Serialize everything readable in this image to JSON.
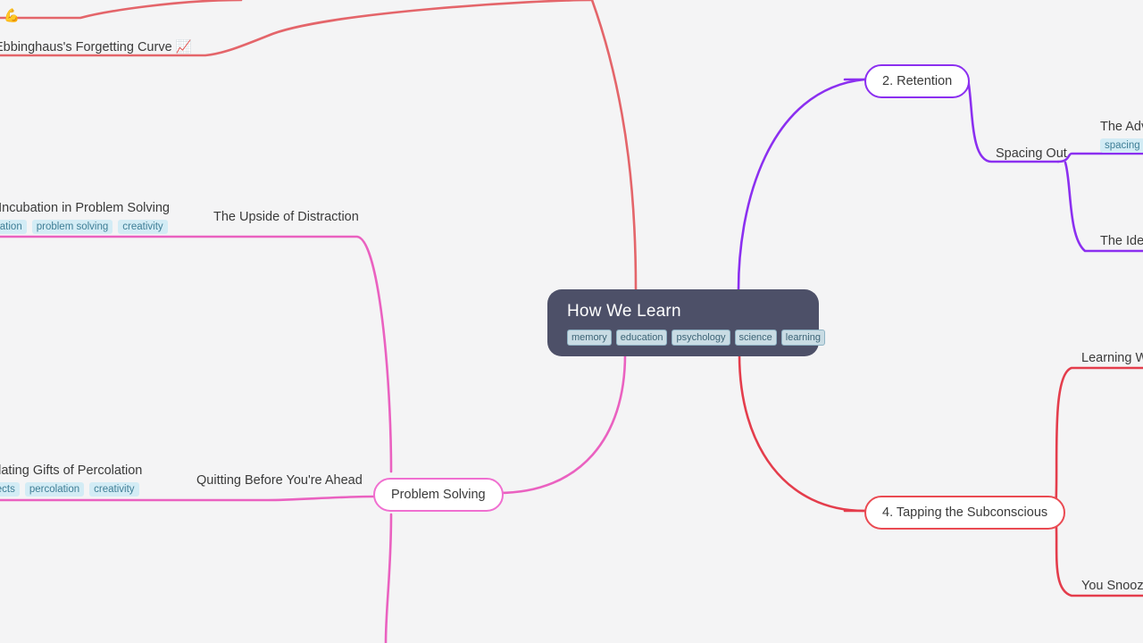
{
  "background_color": "#f4f4f5",
  "root": {
    "title": "How We Learn",
    "tags": [
      "memory",
      "education",
      "psychology",
      "science",
      "learning"
    ],
    "color": "#4d5068"
  },
  "branches": [
    {
      "id": "retention",
      "label": "2. Retention",
      "color": "#8b2ff0"
    },
    {
      "id": "subconscious",
      "label": "4. Tapping the Subconscious",
      "color": "#ea4a52"
    },
    {
      "id": "problem-solving",
      "label": "Problem Solving",
      "color": "#f06fd0"
    }
  ],
  "leaves": [
    {
      "id": "forgetting-curve",
      "title": "Ebbinghaus's Forgetting Curve 📈",
      "tags": [],
      "color": "#ea4a52",
      "clipped": "left"
    },
    {
      "id": "strength-partial",
      "title": "h 💪",
      "tags": [],
      "color": "#ea4a52",
      "clipped": "left"
    },
    {
      "id": "incubation",
      "title": "of Incubation in Problem Solving",
      "tags": [
        "ubation",
        "problem solving",
        "creativity"
      ],
      "color": "#f06fd0",
      "clipped": "left"
    },
    {
      "id": "upside-of-distraction",
      "title": "The Upside of Distraction",
      "tags": [],
      "color": "#f06fd0"
    },
    {
      "id": "percolation",
      "title": "mulating Gifts of Percolation",
      "tags": [
        "rojects",
        "percolation",
        "creativity"
      ],
      "color": "#f06fd0",
      "clipped": "left"
    },
    {
      "id": "quitting-before-ahead",
      "title": "Quitting Before You're Ahead",
      "tags": [],
      "color": "#f06fd0"
    },
    {
      "id": "spacing-out",
      "title": "Spacing Out",
      "tags": [],
      "color": "#8b2ff0"
    },
    {
      "id": "the-advantage",
      "title": "The Adv",
      "tags": [
        "spacing"
      ],
      "color": "#8b2ff0",
      "clipped": "right"
    },
    {
      "id": "the-idea",
      "title": "The Idea",
      "tags": [],
      "color": "#8b2ff0",
      "clipped": "right"
    },
    {
      "id": "learning-while",
      "title": "Learning Wh",
      "tags": [],
      "color": "#ea4a52",
      "clipped": "right"
    },
    {
      "id": "you-snooze",
      "title": "You Snooze",
      "tags": [],
      "color": "#ea4a52",
      "clipped": "right"
    }
  ]
}
